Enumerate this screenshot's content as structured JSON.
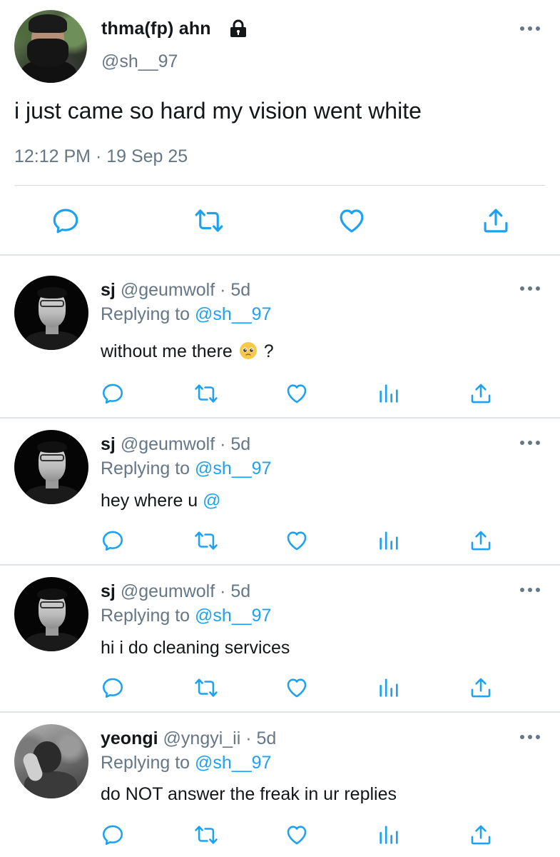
{
  "main_tweet": {
    "display_name": "thma(fp) ahn",
    "handle": "@sh__97",
    "text": "i just came so hard my vision went white",
    "timestamp": "12:12 PM · 19 Sep 25",
    "icons": [
      "lock-icon",
      "more-icon",
      "reply-icon",
      "retweet-icon",
      "like-icon",
      "share-icon"
    ]
  },
  "replies": [
    {
      "name": "sj",
      "meta": "@geumwolf · 5d",
      "replying_prefix": "Replying to ",
      "replying_to": "@sh__97",
      "text_before": "without me there",
      "emoji": "pleading-face-icon",
      "text_after": "?",
      "avatar": "avatar-sj"
    },
    {
      "name": "sj",
      "meta": "@geumwolf · 5d",
      "replying_prefix": "Replying to ",
      "replying_to": "@sh__97",
      "text_before": "hey where u",
      "text_link": "@",
      "avatar": "avatar-sj"
    },
    {
      "name": "sj",
      "meta": "@geumwolf · 5d",
      "replying_prefix": "Replying to ",
      "replying_to": "@sh__97",
      "text_before": "hi i do cleaning services",
      "avatar": "avatar-sj"
    },
    {
      "name": "yeongi",
      "meta": "@yngyi_ii · 5d",
      "replying_prefix": "Replying to ",
      "replying_to": "@sh__97",
      "text_before": "do NOT answer the freak in ur replies",
      "avatar": "avatar-yeongi"
    }
  ],
  "colors": {
    "text": "#14171a",
    "secondary": "#657786",
    "link": "#1da1f2",
    "icon": "#1da1f2",
    "divider": "#dfe3e6"
  }
}
